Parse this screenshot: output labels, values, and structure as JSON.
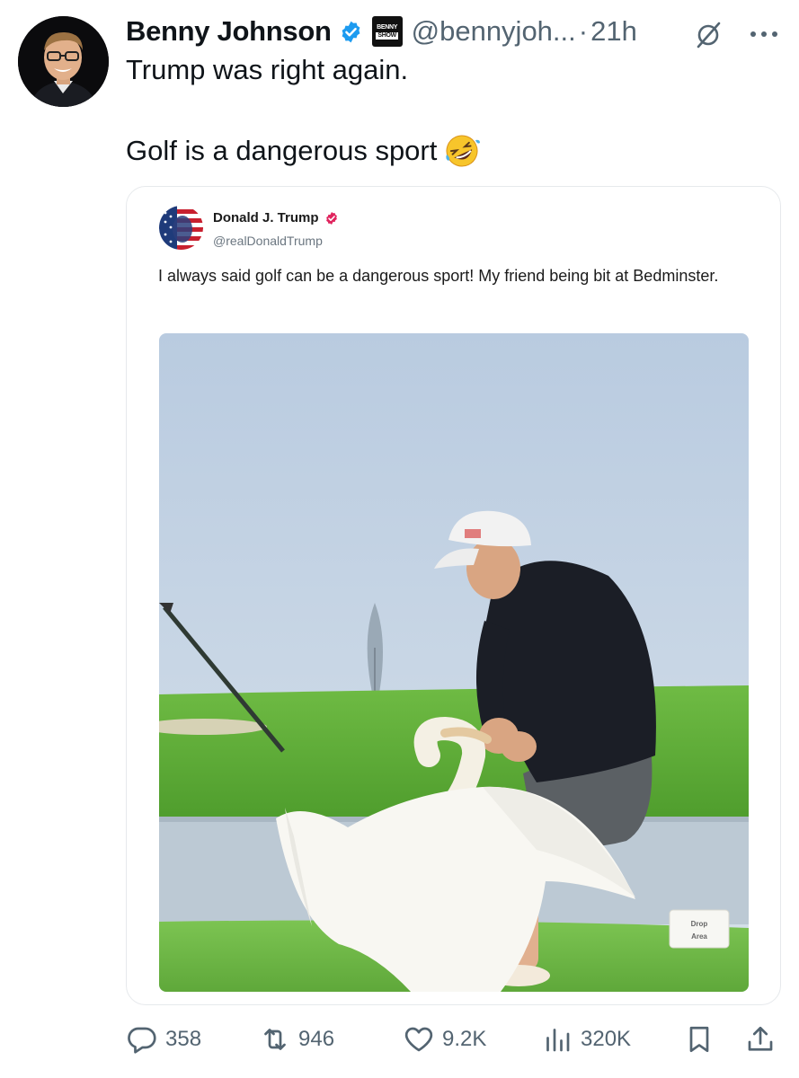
{
  "author": {
    "display_name": "Benny Johnson",
    "handle": "@bennyjoh...",
    "separator": "·",
    "time": "21h",
    "affiliate_badge": [
      "BENNY",
      "SHOW"
    ]
  },
  "tweet": {
    "lines": [
      "Trump was right again.",
      "Golf is a dangerous sport"
    ],
    "emoji": "rolling-on-floor-laughing-emoji"
  },
  "quoted": {
    "display_name": "Donald J. Trump",
    "handle": "@realDonaldTrump",
    "text": "I always said golf can be a dangerous sport! My friend being bit at Bedminster.",
    "image_sign": [
      "Drop",
      "Area"
    ]
  },
  "actions": {
    "replies": "358",
    "reposts": "946",
    "likes": "9.2K",
    "views": "320K"
  },
  "colors": {
    "verified_blue": "#1d9bf0",
    "trump_verified_pink": "#e0245e",
    "secondary_text": "#536471",
    "card_border": "#e6e9ec"
  },
  "icons": [
    "verified-badge-icon",
    "grok-icon",
    "more-icon",
    "reply-icon",
    "repost-icon",
    "like-icon",
    "views-icon",
    "bookmark-icon",
    "share-icon"
  ]
}
